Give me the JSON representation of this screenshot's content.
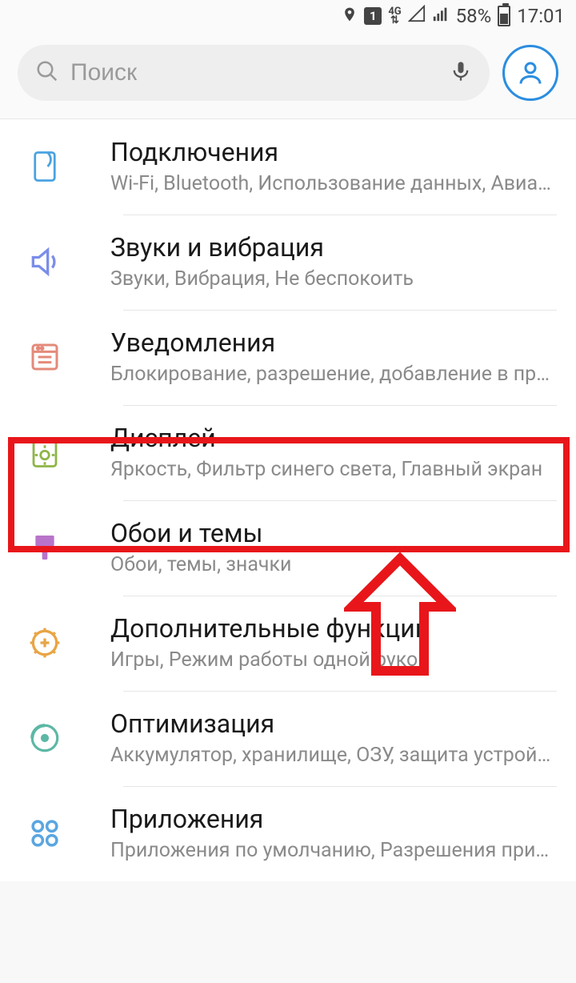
{
  "status": {
    "sim": "1",
    "net_top": "4G",
    "battery_pct": "58%",
    "time": "17:01"
  },
  "search": {
    "placeholder": "Поиск"
  },
  "rows": [
    {
      "title": "Подключения",
      "sub": "Wi-Fi, Bluetooth, Использование данных, Авиарежим"
    },
    {
      "title": "Звуки и вибрация",
      "sub": "Звуки, Вибрация, Не беспокоить"
    },
    {
      "title": "Уведомления",
      "sub": "Блокирование, разрешение, добавление в приоритет"
    },
    {
      "title": "Дисплей",
      "sub": "Яркость, Фильтр синего света, Главный экран"
    },
    {
      "title": "Обои и темы",
      "sub": "Обои, темы, значки"
    },
    {
      "title": "Дополнительные функции",
      "sub": "Игры, Режим работы одной рукой"
    },
    {
      "title": "Оптимизация",
      "sub": "Аккумулятор, хранилище, ОЗУ, защита устройства"
    },
    {
      "title": "Приложения",
      "sub": "Приложения по умолчанию, Разрешения приложений"
    }
  ]
}
